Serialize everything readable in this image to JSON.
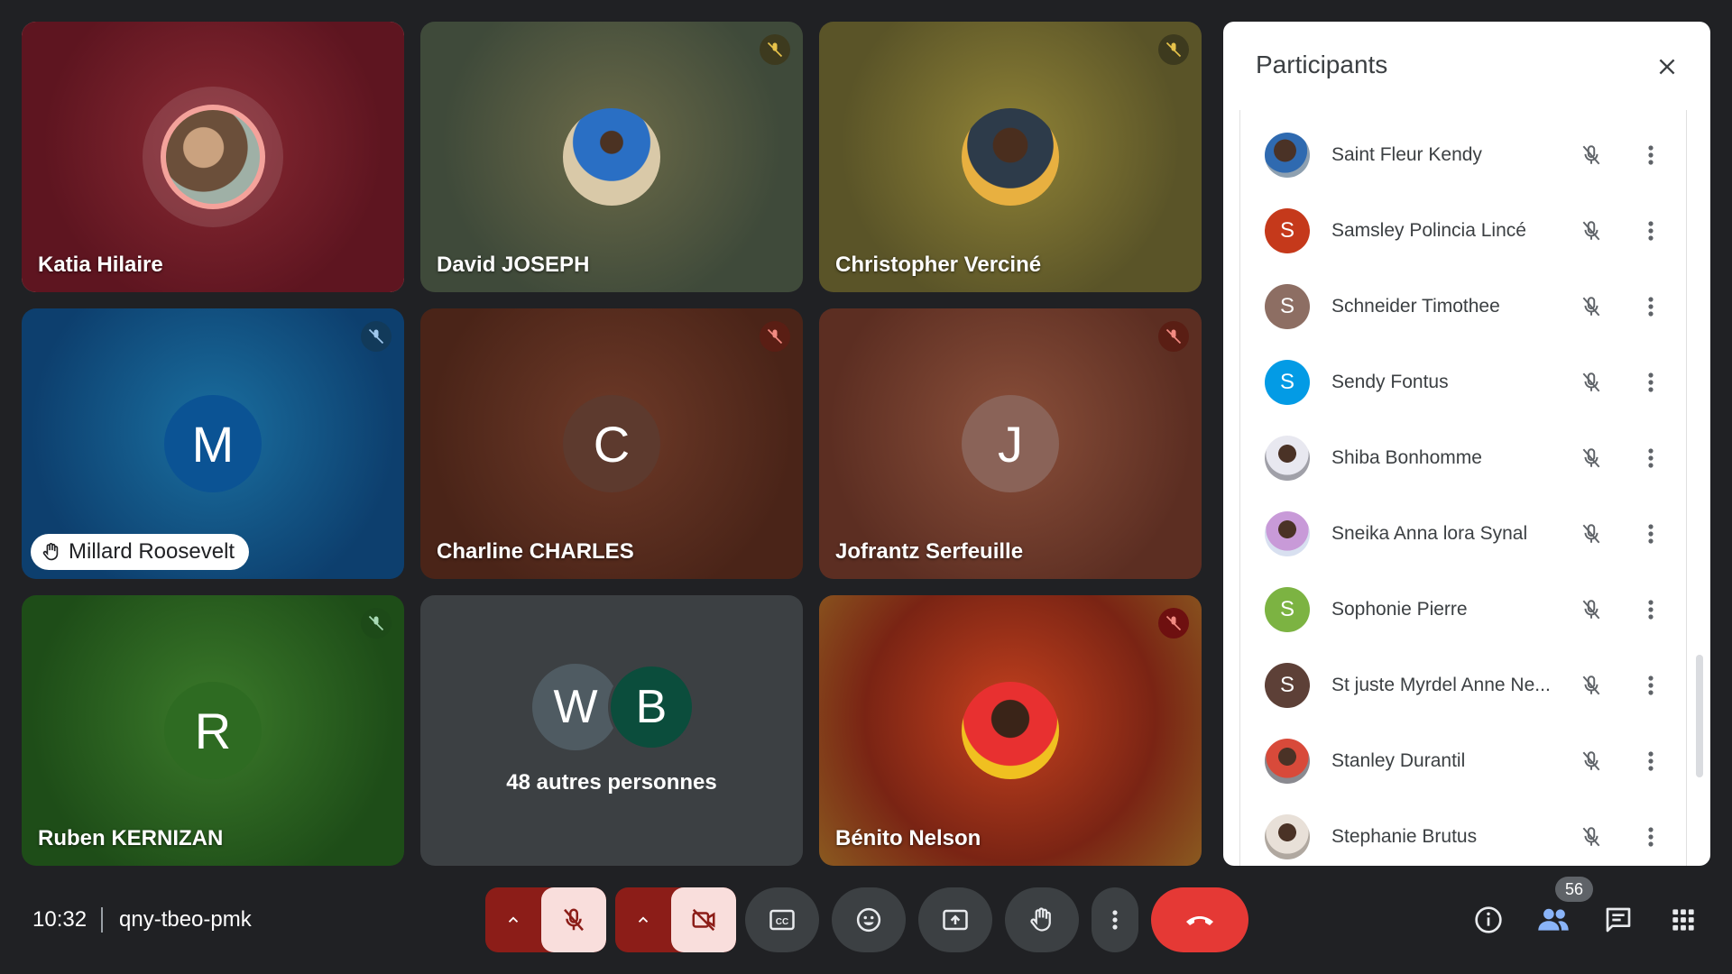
{
  "tiles": [
    {
      "name": "Katia Hilaire",
      "avatar": "photo",
      "muted": false,
      "speaking": true
    },
    {
      "name": "David JOSEPH",
      "avatar": "photo",
      "muted": true
    },
    {
      "name": "Christopher Verciné",
      "avatar": "photo",
      "muted": true
    },
    {
      "name": "Millard Roosevelt",
      "initial": "M",
      "muted": true,
      "hand_raised": true
    },
    {
      "name": "Charline CHARLES",
      "initial": "C",
      "muted": true
    },
    {
      "name": "Jofrantz Serfeuille",
      "initial": "J",
      "muted": true
    },
    {
      "name": "Ruben KERNIZAN",
      "initial": "R",
      "muted": true
    },
    {
      "others_label": "48 autres personnes",
      "initials": [
        "W",
        "B"
      ]
    },
    {
      "name": "Bénito Nelson",
      "avatar": "photo",
      "muted": true
    }
  ],
  "panel": {
    "title": "Participants",
    "participants": [
      {
        "name": "Saint Fleur Kendy",
        "avatar": "photo"
      },
      {
        "name": "Samsley Polincia Lincé",
        "initial": "S",
        "color": "#c5391b"
      },
      {
        "name": "Schneider Timothee",
        "initial": "S",
        "color": "#8d6e63"
      },
      {
        "name": "Sendy Fontus",
        "initial": "S",
        "color": "#039be5"
      },
      {
        "name": "Shiba Bonhomme",
        "avatar": "photo"
      },
      {
        "name": "Sneika Anna lora Synal",
        "avatar": "photo"
      },
      {
        "name": "Sophonie Pierre",
        "initial": "S",
        "color": "#7cb342"
      },
      {
        "name": "St juste Myrdel Anne Ne...",
        "initial": "S",
        "color": "#5d4037"
      },
      {
        "name": "Stanley Durantil",
        "avatar": "photo"
      },
      {
        "name": "Stephanie Brutus",
        "avatar": "photo"
      }
    ]
  },
  "footer": {
    "time": "10:32",
    "meeting_code": "qny-tbeo-pmk",
    "participant_count": "56"
  },
  "colors": {
    "end_call": "#e53935",
    "speaking_ring": "#f4a29b",
    "mic_off_bg": "#f9dedc",
    "group_bg": "#8c1d18"
  },
  "icons": [
    "chevron-up-icon",
    "mic-off-icon",
    "camera-off-icon",
    "captions-icon",
    "emoji-icon",
    "present-icon",
    "raise-hand-icon",
    "more-vert-icon",
    "end-call-icon",
    "info-icon",
    "people-icon",
    "chat-icon",
    "apps-icon",
    "close-icon"
  ]
}
